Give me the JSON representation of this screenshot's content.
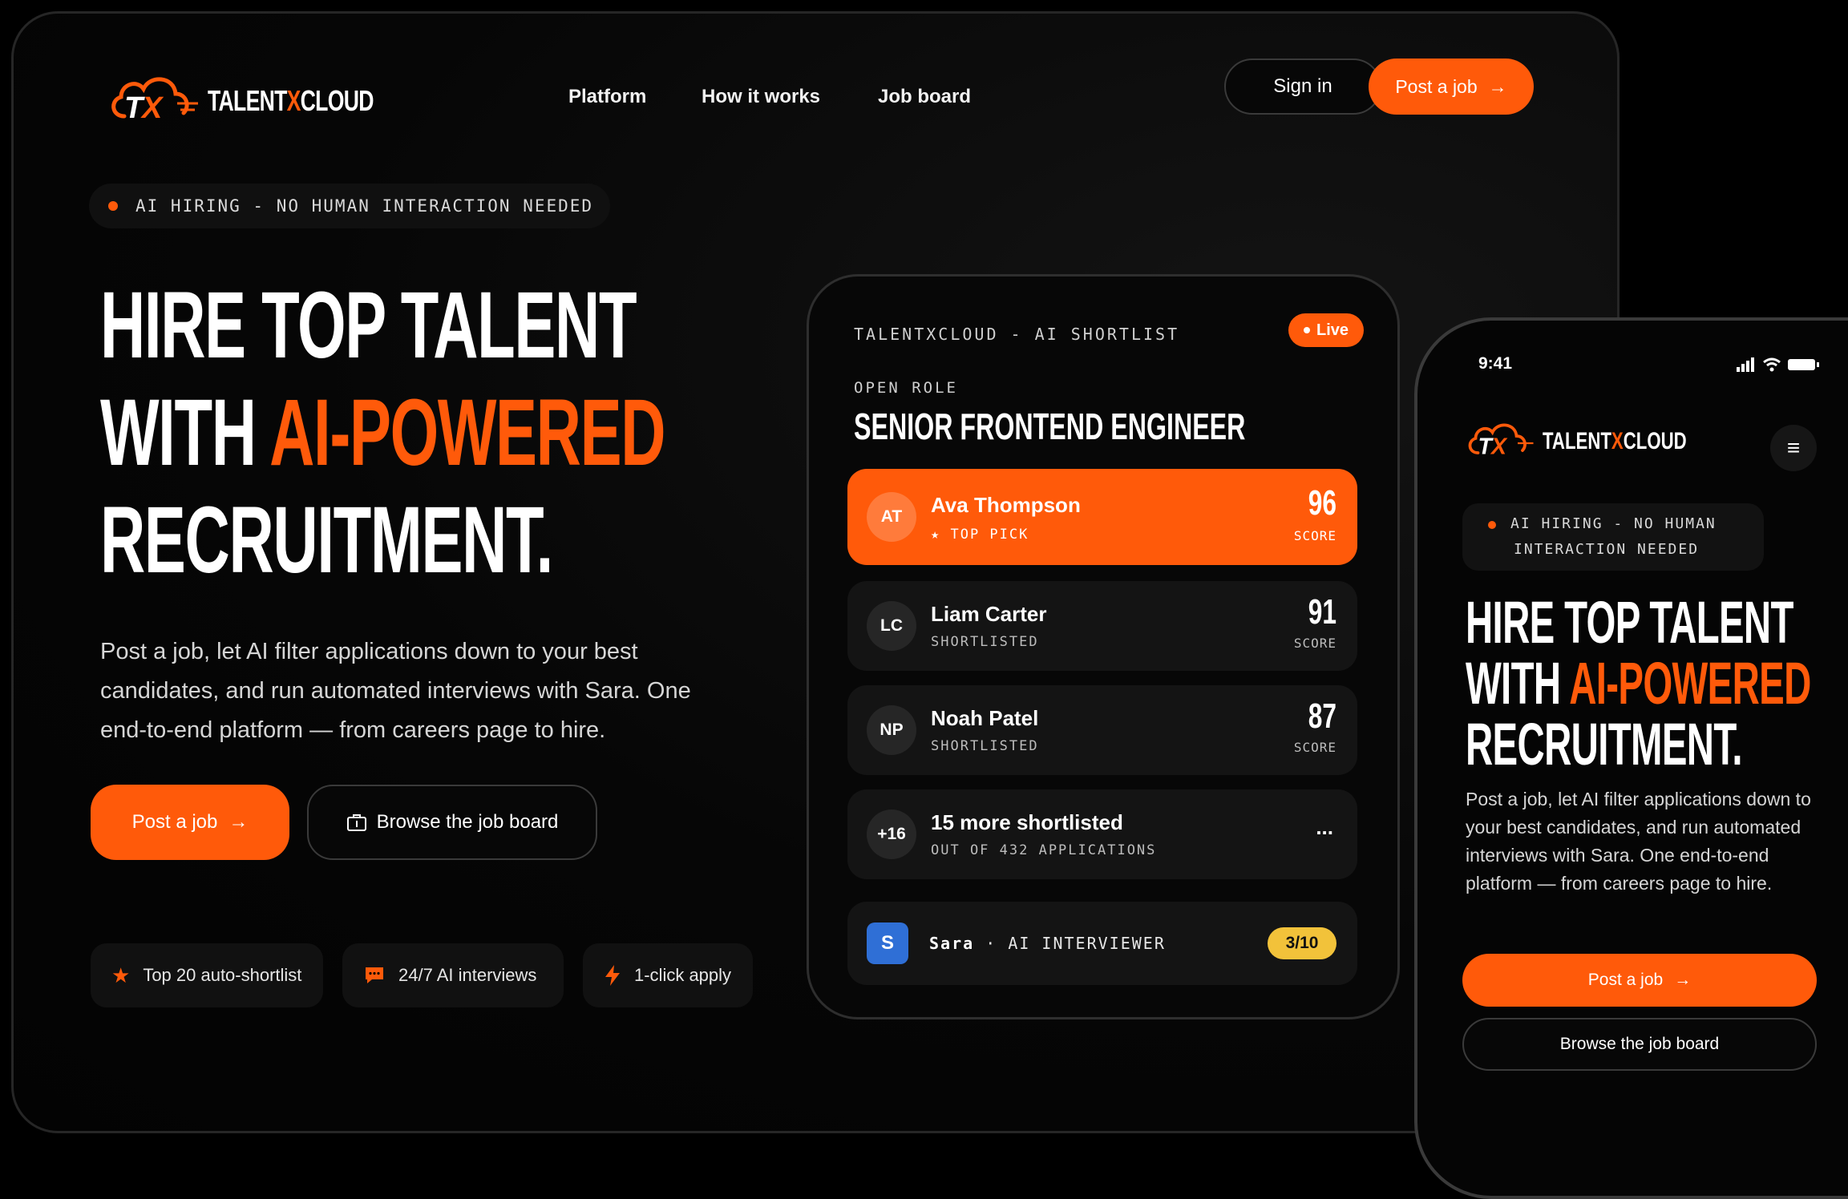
{
  "brand": {
    "name_part1": "TALENT",
    "name_x": "X",
    "name_part2": "CLOUD",
    "logo_letters": "TX"
  },
  "nav": {
    "links": [
      "Platform",
      "How it works",
      "Job board"
    ],
    "sign_in": "Sign in",
    "post_job": "Post a job"
  },
  "hero": {
    "badge": "AI HIRING - NO HUMAN INTERACTION NEEDED",
    "line1": "HIRE TOP TALENT",
    "line2_prefix": "WITH ",
    "line2_accent": "AI-POWERED",
    "line3": "RECRUITMENT.",
    "subtitle": "Post a job, let AI filter applications down to your best candidates, and run automated interviews with Sara. One end-to-end platform — from careers page to hire.",
    "cta_primary": "Post a job",
    "cta_secondary": "Browse the job board",
    "features": [
      {
        "icon": "star-icon",
        "label": "Top 20 auto-shortlist"
      },
      {
        "icon": "chat-icon",
        "label": "24/7 AI interviews"
      },
      {
        "icon": "bolt-icon",
        "label": "1-click apply"
      }
    ]
  },
  "shortlist": {
    "header": "TALENTXCLOUD - AI SHORTLIST",
    "live": "Live",
    "open_role_label": "OPEN ROLE",
    "role_title": "SENIOR FRONTEND ENGINEER",
    "candidates": [
      {
        "initials": "AT",
        "name": "Ava Thompson",
        "status": "TOP PICK",
        "score": "96",
        "score_label": "SCORE"
      },
      {
        "initials": "LC",
        "name": "Liam Carter",
        "status": "SHORTLISTED",
        "score": "91",
        "score_label": "SCORE"
      },
      {
        "initials": "NP",
        "name": "Noah Patel",
        "status": "SHORTLISTED",
        "score": "87",
        "score_label": "SCORE"
      }
    ],
    "more": {
      "badge": "+16",
      "title": "15 more shortlisted",
      "sub": "OUT OF 432 APPLICATIONS",
      "menu": "..."
    },
    "interviewer": {
      "initial": "S",
      "name": "Sara",
      "separator": "·",
      "role": "AI INTERVIEWER",
      "progress": "3/10"
    }
  },
  "phone": {
    "time": "9:41",
    "badge_line1": "AI HIRING - NO HUMAN",
    "badge_line2": "INTERACTION NEEDED",
    "line1": "HIRE TOP TALENT",
    "line2_prefix": "WITH ",
    "line2_accent": "AI-POWERED",
    "line3": "RECRUITMENT.",
    "subtitle": "Post a job, let AI filter applications down to your best candidates, and run automated interviews with Sara. One end-to-end platform — from careers page to hire.",
    "cta_primary": "Post a job",
    "cta_secondary": "Browse the job board"
  },
  "colors": {
    "accent": "#ff5a0a",
    "background": "#000000",
    "interviewer_badge": "#2f6fd6",
    "progress_pill": "#f2c23a"
  }
}
